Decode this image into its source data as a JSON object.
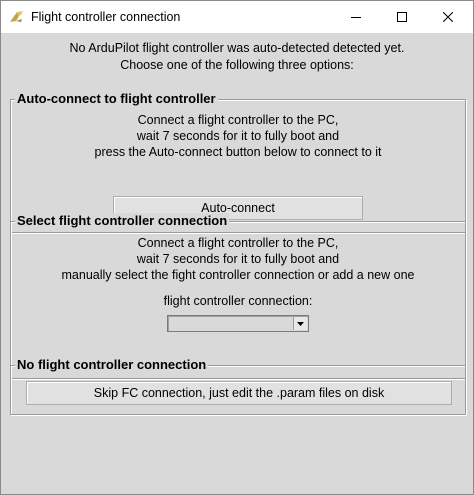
{
  "window": {
    "title": "Flight controller connection"
  },
  "intro": {
    "line1": "No ArduPilot flight controller was auto-detected detected yet.",
    "line2": "Choose one of the following three options:"
  },
  "auto_connect": {
    "title": "Auto-connect to flight controller",
    "line1": "Connect a flight controller to the PC,",
    "line2": "wait 7 seconds for it to fully boot and",
    "line3": "press the Auto-connect button below to connect to it",
    "button_label": "Auto-connect"
  },
  "select_connection": {
    "title": "Select flight controller connection",
    "line1": "Connect a flight controller to the PC,",
    "line2": "wait 7 seconds for it to fully boot and",
    "line3": "manually select the fight controller connection or add a new one",
    "combo_label": "flight controller connection:",
    "combo_value": ""
  },
  "no_connection": {
    "title": "No flight controller connection",
    "button_label": "Skip FC connection, just edit the .param files on disk"
  },
  "icons": {
    "app": "ardupilot-logo-icon",
    "minimize": "minimize-icon",
    "maximize": "maximize-icon",
    "close": "close-icon",
    "dropdown": "chevron-down-icon"
  }
}
